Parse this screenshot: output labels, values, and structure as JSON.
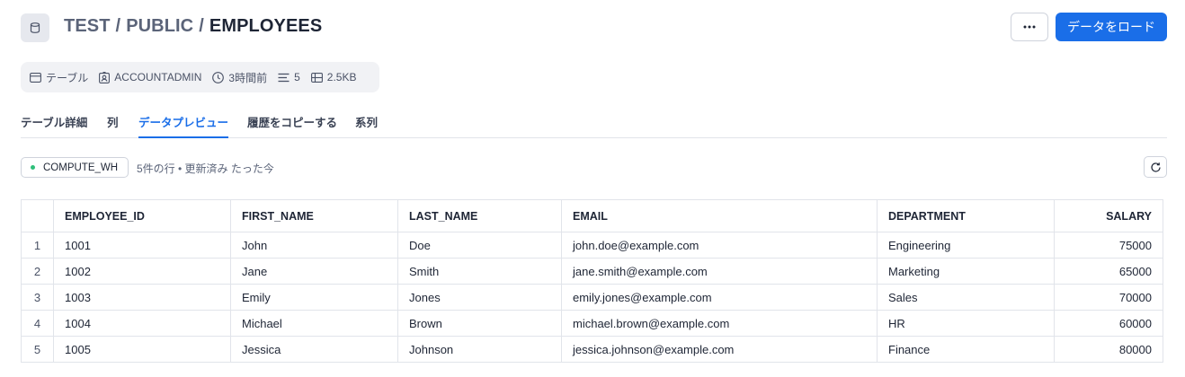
{
  "header": {
    "breadcrumb": [
      "TEST",
      "PUBLIC"
    ],
    "separator": "/",
    "current": "EMPLOYEES",
    "more_label": "•••",
    "load_button": "データをロード"
  },
  "meta": {
    "type": "テーブル",
    "owner": "ACCOUNTADMIN",
    "updated": "3時間前",
    "rows": "5",
    "size": "2.5KB"
  },
  "tabs": [
    {
      "label": "テーブル詳細"
    },
    {
      "label": "列"
    },
    {
      "label": "データプレビュー",
      "active": true
    },
    {
      "label": "履歴をコピーする"
    },
    {
      "label": "系列"
    }
  ],
  "toolbar": {
    "warehouse": "COMPUTE_WH",
    "status": "5件の行 • 更新済み たった今"
  },
  "table": {
    "columns": [
      "",
      "EMPLOYEE_ID",
      "FIRST_NAME",
      "LAST_NAME",
      "EMAIL",
      "DEPARTMENT",
      "SALARY"
    ],
    "rows": [
      [
        "1",
        "1001",
        "John",
        "Doe",
        "john.doe@example.com",
        "Engineering",
        "75000"
      ],
      [
        "2",
        "1002",
        "Jane",
        "Smith",
        "jane.smith@example.com",
        "Marketing",
        "65000"
      ],
      [
        "3",
        "1003",
        "Emily",
        "Jones",
        "emily.jones@example.com",
        "Sales",
        "70000"
      ],
      [
        "4",
        "1004",
        "Michael",
        "Brown",
        "michael.brown@example.com",
        "HR",
        "60000"
      ],
      [
        "5",
        "1005",
        "Jessica",
        "Johnson",
        "jessica.johnson@example.com",
        "Finance",
        "80000"
      ]
    ]
  },
  "colors": {
    "accent": "#1a6ee8",
    "warehouse_dot": "#2fbf7a"
  }
}
